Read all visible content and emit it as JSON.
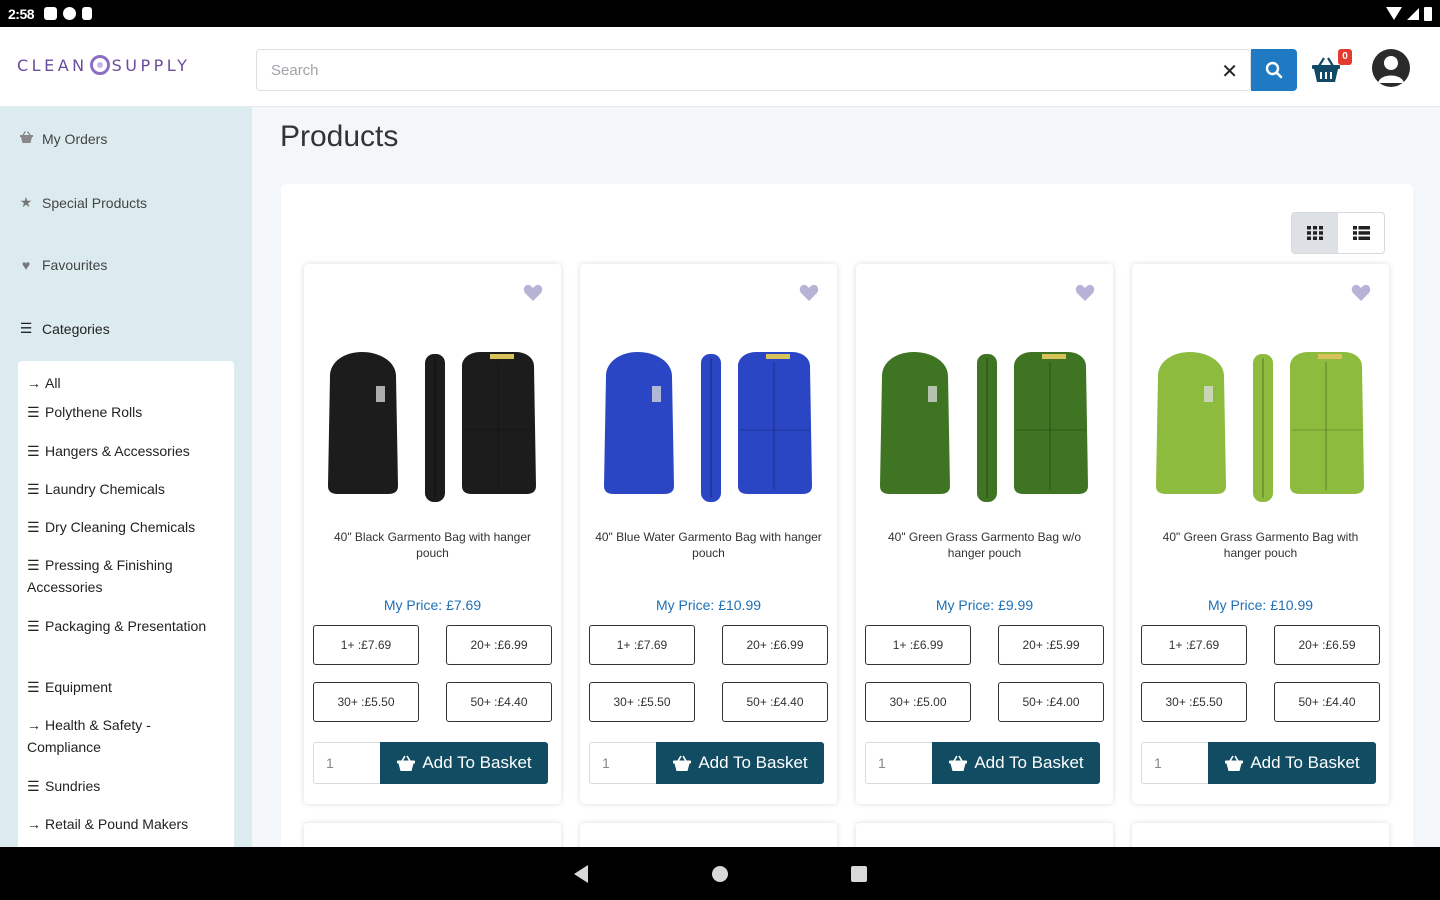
{
  "status_bar": {
    "time": "2:58"
  },
  "header": {
    "logo_left": "CLEAN",
    "logo_right": "SUPPLY",
    "search_placeholder": "Search",
    "clear_symbol": "✕",
    "basket_count": "0"
  },
  "sidebar": {
    "links": [
      {
        "label": "My Orders",
        "icon": "basket-icon"
      },
      {
        "label": "Special Products",
        "icon": "star-icon"
      },
      {
        "label": "Favourites",
        "icon": "heart-icon"
      },
      {
        "label": "Categories",
        "icon": "bars-icon"
      }
    ],
    "categories": [
      {
        "label": "All",
        "icon": "arrow-right-icon"
      },
      {
        "label": "Polythene Rolls",
        "icon": "bars-icon"
      },
      {
        "label": "Hangers & Accessories",
        "icon": "bars-icon"
      },
      {
        "label": "Laundry Chemicals",
        "icon": "bars-icon"
      },
      {
        "label": "Dry Cleaning Chemicals",
        "icon": "bars-icon"
      },
      {
        "label": "Pressing & Finishing Accessories",
        "icon": "bars-icon"
      },
      {
        "label": "Packaging & Presentation",
        "icon": "bars-icon"
      },
      {
        "label": "Equipment",
        "icon": "bars-icon"
      },
      {
        "label": "Health & Safety - Compliance",
        "icon": "arrow-right-icon"
      },
      {
        "label": "Sundries",
        "icon": "bars-icon"
      },
      {
        "label": "Retail & Pound Makers",
        "icon": "arrow-right-icon"
      }
    ]
  },
  "main": {
    "title": "Products",
    "add_label": "Add To Basket",
    "products": [
      {
        "name": "40\" Black Garmento Bag with hanger pouch",
        "price": "My Price: £7.69",
        "tiers": [
          "1+ :£7.69",
          "20+ :£6.99",
          "30+ :£5.50",
          "50+ :£4.40"
        ],
        "qty": "1",
        "color": "#1c1c1c"
      },
      {
        "name": "40\" Blue Water Garmento Bag with hanger pouch",
        "price": "My Price: £10.99",
        "tiers": [
          "1+ :£7.69",
          "20+ :£6.99",
          "30+ :£5.50",
          "50+ :£4.40"
        ],
        "qty": "1",
        "color": "#2a46c4"
      },
      {
        "name": "40\" Green Grass Garmento Bag w/o hanger pouch",
        "price": "My Price: £9.99",
        "tiers": [
          "1+ :£6.99",
          "20+ :£5.99",
          "30+ :£5.00",
          "50+ :£4.00"
        ],
        "qty": "1",
        "color": "#3f7422"
      },
      {
        "name": "40\" Green Grass Garmento Bag with hanger pouch",
        "price": "My Price: £10.99",
        "tiers": [
          "1+ :£7.69",
          "20+ :£6.59",
          "30+ :£5.50",
          "50+ :£4.40"
        ],
        "qty": "1",
        "color": "#8dbb3e"
      }
    ]
  },
  "colors": {
    "accent_blue": "#1f7ac3",
    "button_teal": "#114c63",
    "sidebar_bg": "#dcebef",
    "price_blue": "#1f6fb5",
    "heart_lavender": "#b7b3d6"
  }
}
